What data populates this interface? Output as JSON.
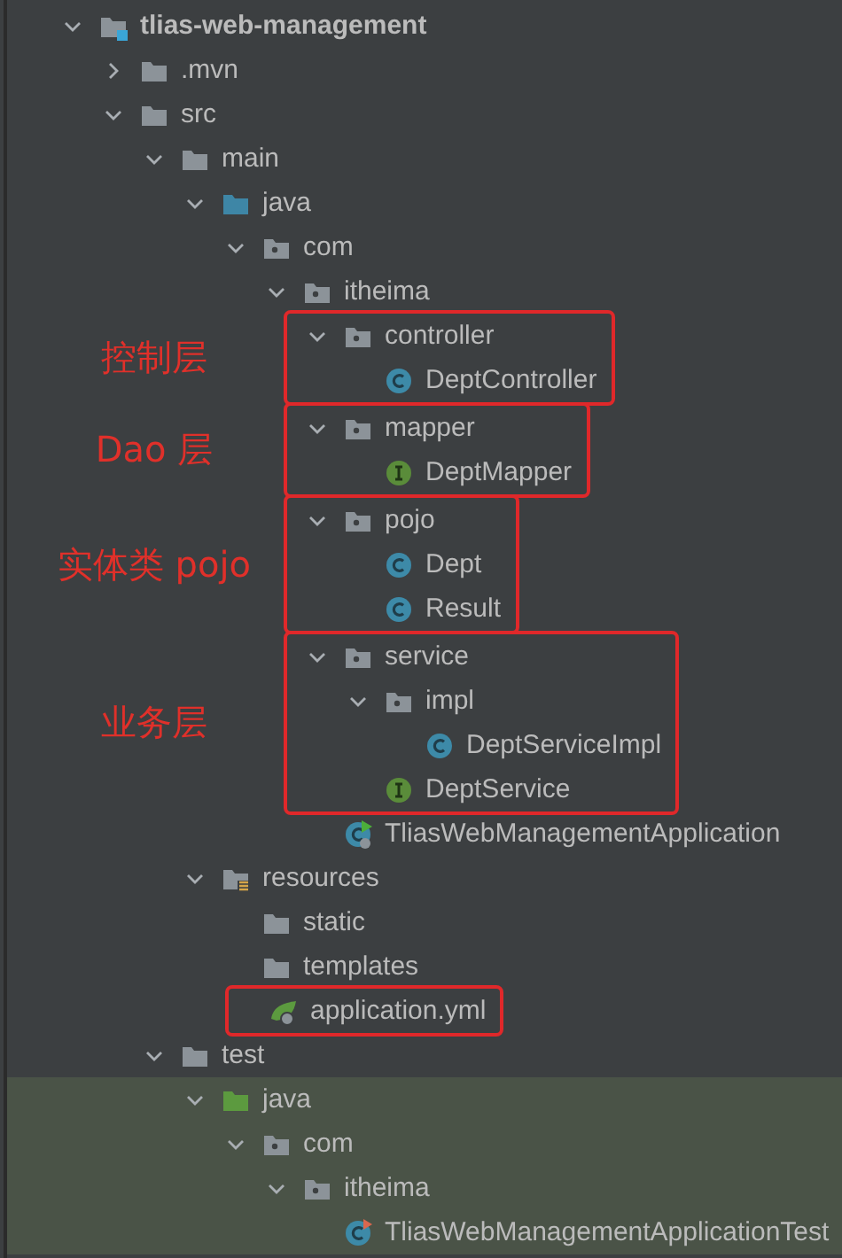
{
  "tree": {
    "label": "tlias-web-management",
    "kind": "module",
    "expanded": true,
    "highlighted": false,
    "outlined": false,
    "children": [
      {
        "label": ".mvn",
        "kind": "folder",
        "expanded": false,
        "highlighted": false,
        "outlined": false
      },
      {
        "label": "src",
        "kind": "folder",
        "expanded": true,
        "highlighted": false,
        "outlined": false,
        "children": [
          {
            "label": "main",
            "kind": "folder",
            "expanded": true,
            "highlighted": false,
            "outlined": false,
            "children": [
              {
                "label": "java",
                "kind": "source",
                "expanded": true,
                "highlighted": false,
                "outlined": false,
                "children": [
                  {
                    "label": "com",
                    "kind": "package",
                    "expanded": true,
                    "highlighted": false,
                    "outlined": false,
                    "children": [
                      {
                        "label": "itheima",
                        "kind": "package",
                        "expanded": true,
                        "highlighted": false,
                        "outlined": false,
                        "children": [
                          {
                            "label": "controller",
                            "kind": "package",
                            "expanded": true,
                            "highlighted": false,
                            "outlined": true,
                            "note": "控制层",
                            "children": [
                              {
                                "label": "DeptController",
                                "kind": "class",
                                "highlighted": false,
                                "outlined": false
                              }
                            ]
                          },
                          {
                            "label": "mapper",
                            "kind": "package",
                            "expanded": true,
                            "highlighted": false,
                            "outlined": true,
                            "note": "Dao 层",
                            "children": [
                              {
                                "label": "DeptMapper",
                                "kind": "interface",
                                "highlighted": false,
                                "outlined": false
                              }
                            ]
                          },
                          {
                            "label": "pojo",
                            "kind": "package",
                            "expanded": true,
                            "highlighted": false,
                            "outlined": true,
                            "note": "实体类 pojo",
                            "children": [
                              {
                                "label": "Dept",
                                "kind": "class",
                                "highlighted": false,
                                "outlined": false
                              },
                              {
                                "label": "Result",
                                "kind": "class",
                                "highlighted": false,
                                "outlined": false
                              }
                            ]
                          },
                          {
                            "label": "service",
                            "kind": "package",
                            "expanded": true,
                            "highlighted": false,
                            "outlined": true,
                            "note": "业务层",
                            "children": [
                              {
                                "label": "impl",
                                "kind": "package",
                                "expanded": true,
                                "highlighted": false,
                                "outlined": false,
                                "children": [
                                  {
                                    "label": "DeptServiceImpl",
                                    "kind": "class",
                                    "highlighted": false,
                                    "outlined": false
                                  }
                                ]
                              },
                              {
                                "label": "DeptService",
                                "kind": "interface",
                                "highlighted": false,
                                "outlined": false
                              }
                            ]
                          },
                          {
                            "label": "TliasWebManagementApplication",
                            "kind": "app-class",
                            "highlighted": false,
                            "outlined": false
                          }
                        ]
                      }
                    ]
                  }
                ]
              },
              {
                "label": "resources",
                "kind": "resources",
                "expanded": true,
                "highlighted": false,
                "outlined": false,
                "children": [
                  {
                    "label": "static",
                    "kind": "folder",
                    "highlighted": false,
                    "outlined": false
                  },
                  {
                    "label": "templates",
                    "kind": "folder",
                    "highlighted": false,
                    "outlined": false
                  },
                  {
                    "label": "application.yml",
                    "kind": "config",
                    "highlighted": false,
                    "outlined": true
                  }
                ]
              }
            ]
          },
          {
            "label": "test",
            "kind": "folder",
            "expanded": true,
            "highlighted": false,
            "outlined": false,
            "children": [
              {
                "label": "java",
                "kind": "test-source",
                "expanded": true,
                "highlighted": true,
                "outlined": false,
                "children": [
                  {
                    "label": "com",
                    "kind": "package",
                    "expanded": true,
                    "highlighted": true,
                    "outlined": false,
                    "children": [
                      {
                        "label": "itheima",
                        "kind": "package",
                        "expanded": true,
                        "highlighted": true,
                        "outlined": false,
                        "children": [
                          {
                            "label": "TliasWebManagementApplicationTest",
                            "kind": "test-class",
                            "highlighted": true,
                            "outlined": false
                          }
                        ]
                      }
                    ]
                  }
                ]
              }
            ]
          }
        ]
      }
    ]
  }
}
